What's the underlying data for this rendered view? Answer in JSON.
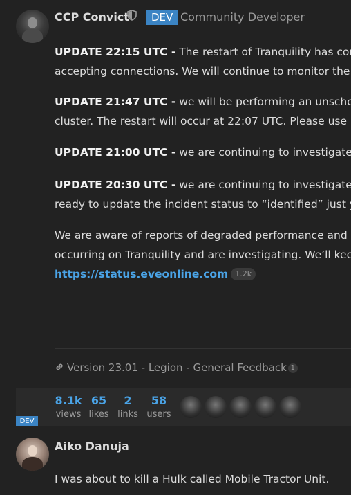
{
  "post": {
    "author": "CCP Convict",
    "badge": "DEV",
    "user_title": "Community Developer",
    "updates": [
      {
        "label": "UPDATE 22:15 UTC -",
        "lines": [
          " The restart of Tranquility has com",
          "accepting connections. We will continue to monitor the"
        ]
      },
      {
        "label": "UPDATE 21:47 UTC -",
        "lines": [
          " we will be performing an unsche",
          "cluster. The restart will occur at 22:07 UTC. Please use"
        ]
      },
      {
        "label": "UPDATE 21:00 UTC -",
        "lines": [
          " we are continuing to investigate"
        ]
      },
      {
        "label": "UPDATE 20:30 UTC -",
        "lines": [
          " we are continuing to investigate",
          "ready to update the incident status to “identified” just y"
        ]
      }
    ],
    "body_lines": [
      "We are aware of reports of degraded performance and",
      "occurring on Tranquility and are investigating. We’ll kee"
    ],
    "status_link": "https://status.eveonline.com",
    "status_link_clicks": "1.2k",
    "topic_link": "Version 23.01 - Legion - General Feedback",
    "topic_link_count": "1"
  },
  "stats": {
    "views": {
      "value": "8.1k",
      "label": "views"
    },
    "likes": {
      "value": "65",
      "label": "likes"
    },
    "links": {
      "value": "2",
      "label": "links"
    },
    "users": {
      "value": "58",
      "label": "users"
    },
    "dev_flair": "DEV"
  },
  "reply": {
    "author": "Aiko Danuja",
    "text": "I was about to kill a Hulk called Mobile Tractor Unit."
  }
}
